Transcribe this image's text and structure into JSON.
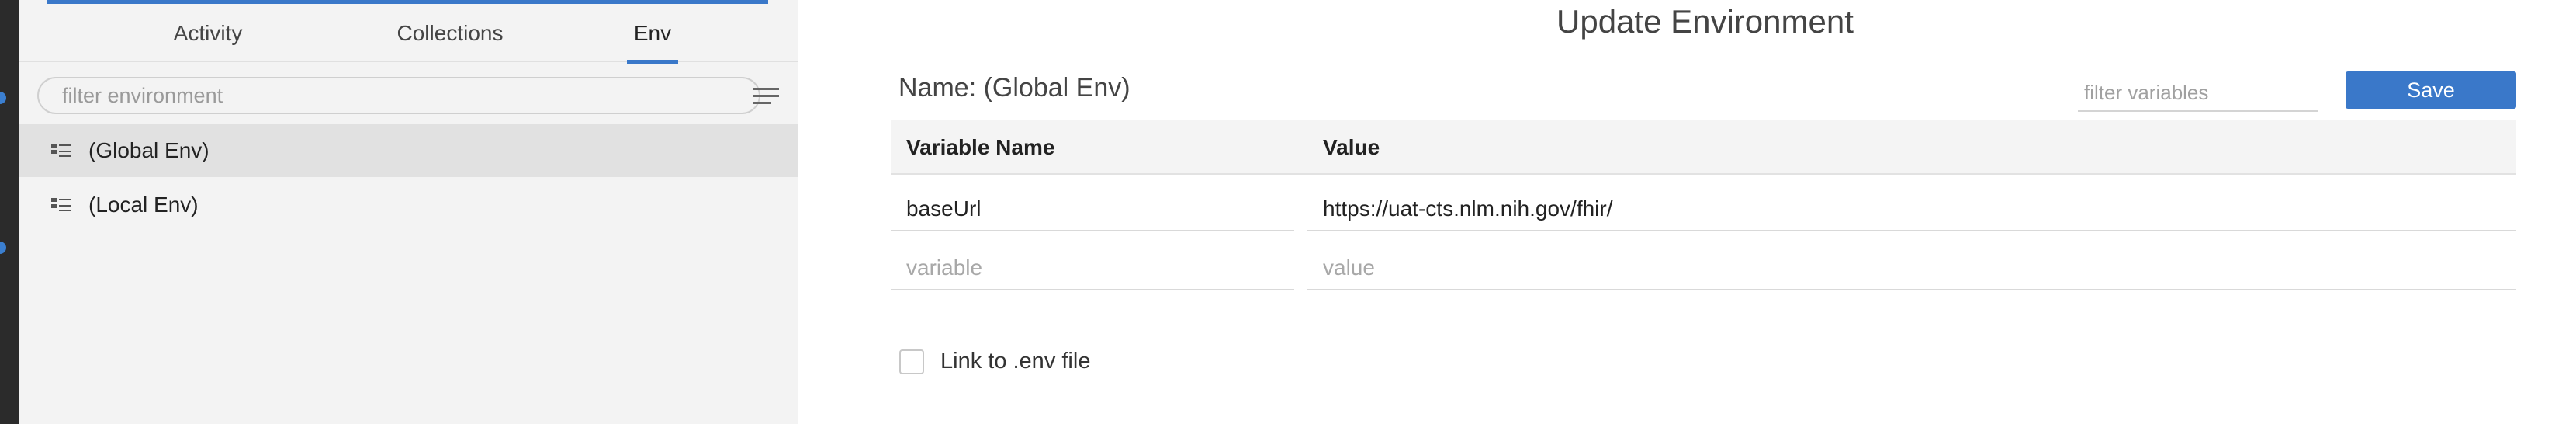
{
  "sidebar": {
    "tabs": [
      {
        "label": "Activity",
        "active": false
      },
      {
        "label": "Collections",
        "active": false
      },
      {
        "label": "Env",
        "active": true
      }
    ],
    "filter": {
      "placeholder": "filter environment",
      "value": ""
    },
    "menu_icon": "hamburger-menu-icon",
    "items": [
      {
        "label": "(Global Env)",
        "selected": true,
        "icon": "list-icon"
      },
      {
        "label": "(Local Env)",
        "selected": false,
        "icon": "list-icon"
      }
    ]
  },
  "main": {
    "title": "Update Environment",
    "name_label": "Name: (Global Env)",
    "filter_variables": {
      "placeholder": "filter variables",
      "value": ""
    },
    "save_label": "Save",
    "table": {
      "headers": [
        "Variable Name",
        "Value"
      ],
      "rows": [
        {
          "variable": "baseUrl",
          "value": "https://uat-cts.nlm.nih.gov/fhir/"
        }
      ],
      "new_row": {
        "variable_placeholder": "variable",
        "value_placeholder": "value"
      }
    },
    "link_env": {
      "label": "Link to .env file",
      "checked": false
    }
  },
  "colors": {
    "accent": "#3a78c9",
    "sidebar_bg": "#f3f3f3",
    "selected_bg": "#e1e1e1"
  }
}
